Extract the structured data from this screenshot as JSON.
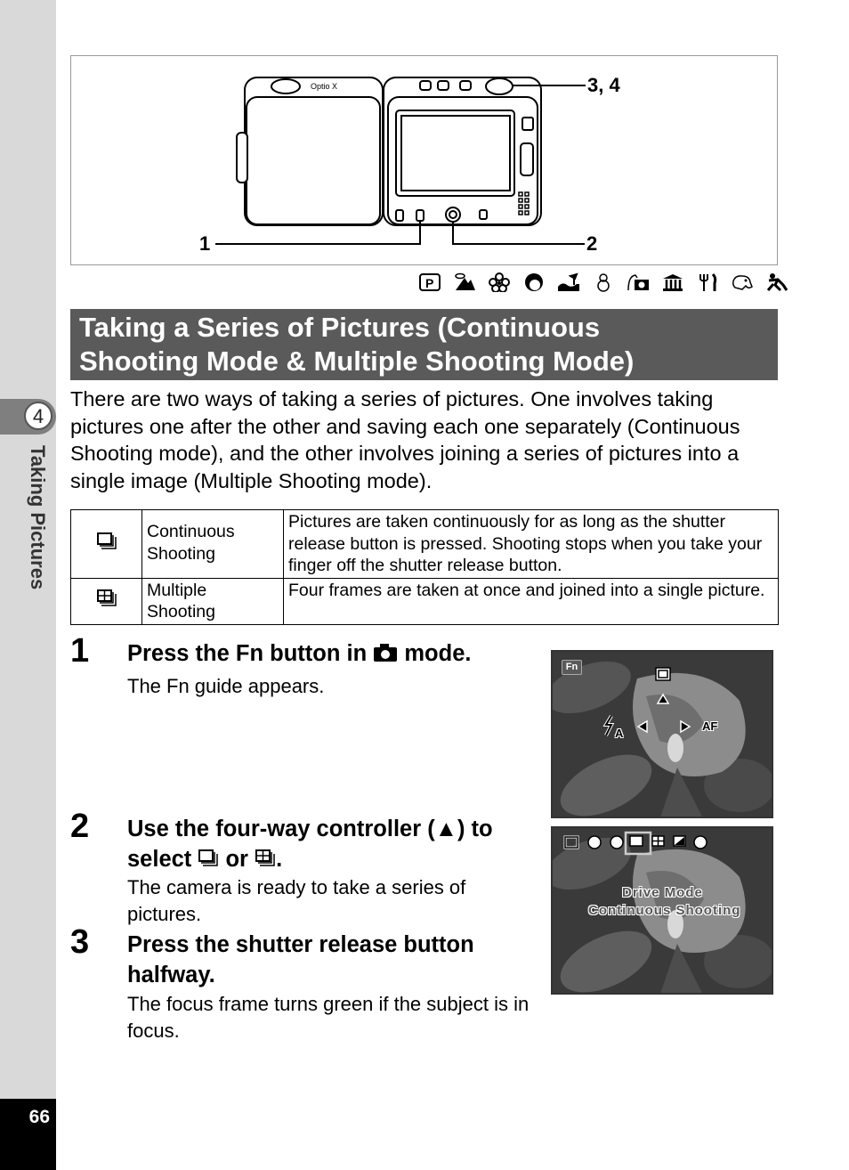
{
  "sidebar": {
    "chapter_number": "4",
    "chapter_title": "Taking Pictures",
    "page_number": "66"
  },
  "figure": {
    "camera_brand_label": "Optio X",
    "callouts": [
      "1",
      "2",
      "3, 4"
    ]
  },
  "mode_icons": [
    "program-mode",
    "landscape-mode",
    "flower-mode",
    "portrait-mode",
    "surf-snow-mode",
    "snow-mode",
    "self-portrait-mode",
    "museum-mode",
    "food-mode",
    "pet-mode",
    "sport-mode"
  ],
  "section": {
    "title": "Taking a Series of Pictures (Continuous Shooting Mode & Multiple Shooting Mode)",
    "title_line1": "Taking a Series of Pictures (Continuous",
    "title_line2": "Shooting Mode & Multiple Shooting Mode)",
    "intro": "There are two ways of taking a series of pictures. One involves taking pictures one after the other and saving each one separately (Continuous Shooting mode), and the other involves joining a series of pictures into a single image (Multiple Shooting mode)."
  },
  "modes_table": [
    {
      "icon": "continuous-shooting-icon",
      "name_line1": "Continuous",
      "name_line2": "Shooting",
      "description": "Pictures are taken continuously for as long as the shutter release button is pressed. Shooting stops when you take your finger off the shutter release button."
    },
    {
      "icon": "multiple-shooting-icon",
      "name_line1": "Multiple",
      "name_line2": "Shooting",
      "description": "Four frames are taken at once and joined into a single picture."
    }
  ],
  "steps": [
    {
      "number": "1",
      "title_part1": "Press the ",
      "title_fn": "Fn",
      "title_part2": " button in ",
      "title_part3": " mode.",
      "description": "The Fn guide appears."
    },
    {
      "number": "2",
      "title_line1": "Use the four-way controller (▲) to",
      "title_line2_a": "select ",
      "title_line2_b": " or ",
      "title_line2_c": ".",
      "description": "The camera is ready to take a series of pictures."
    },
    {
      "number": "3",
      "title_line1": "Press the shutter release button",
      "title_line2": "halfway.",
      "description": "The focus frame turns green if the subject is in focus."
    }
  ],
  "screen1": {
    "fn_label": "Fn",
    "af_label": "AF",
    "flash_label": "ϞA"
  },
  "screen2": {
    "line1": "Drive Mode",
    "line2": "Continuous Shooting"
  }
}
